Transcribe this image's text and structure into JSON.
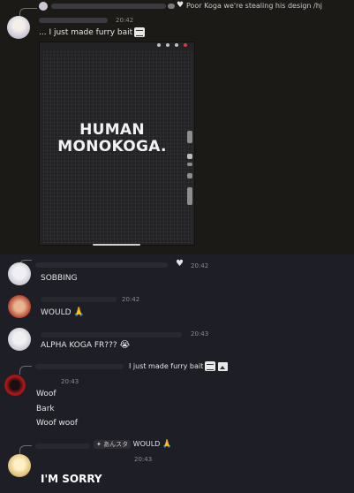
{
  "messages": [
    {
      "reply_preview": "Poor Koga we're stealing his design /hj",
      "time": "20:42",
      "text": "... I just made furry bait",
      "image_text": "HUMAN\nMONOKOGA."
    },
    {
      "time": "20:42",
      "text": "SOBBING"
    },
    {
      "time": "20:42",
      "text": "WOULD"
    },
    {
      "time": "20:43",
      "text": "ALPHA KOGA FR???"
    },
    {
      "reply_preview": "I just made furry bait",
      "time": "20:43",
      "lines": [
        "Woof",
        "Bark",
        "Woof woof"
      ]
    },
    {
      "reply_author": "あんスタ",
      "reply_preview": "WOULD",
      "time": "20:43",
      "text": "I'M SORRY"
    }
  ],
  "colors": {
    "background_top": "#1c1a17",
    "background_bottom": "#1e1e26",
    "text": "#e4e4e6",
    "timestamp": "#8a8a90"
  },
  "icons": [
    "heart-icon",
    "sticker-icon",
    "image-icon",
    "pray-emoji",
    "sob-emoji"
  ]
}
